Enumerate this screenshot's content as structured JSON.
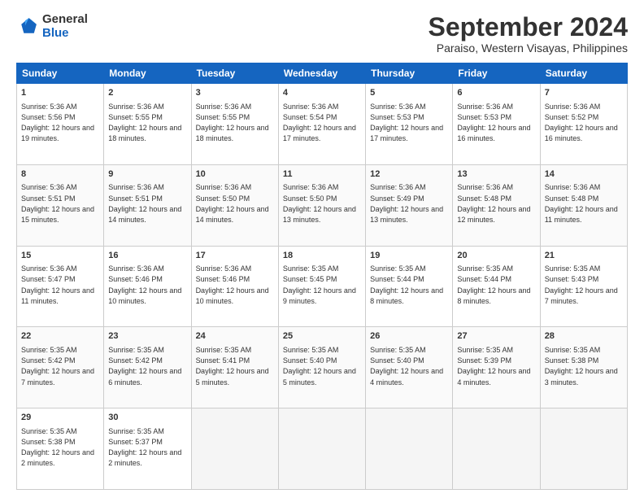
{
  "header": {
    "logo": {
      "line1": "General",
      "line2": "Blue"
    },
    "title": "September 2024",
    "subtitle": "Paraiso, Western Visayas, Philippines"
  },
  "calendar": {
    "weekdays": [
      "Sunday",
      "Monday",
      "Tuesday",
      "Wednesday",
      "Thursday",
      "Friday",
      "Saturday"
    ],
    "weeks": [
      [
        {
          "day": "1",
          "sunrise": "5:36 AM",
          "sunset": "5:56 PM",
          "daylight": "12 hours and 19 minutes."
        },
        {
          "day": "2",
          "sunrise": "5:36 AM",
          "sunset": "5:55 PM",
          "daylight": "12 hours and 18 minutes."
        },
        {
          "day": "3",
          "sunrise": "5:36 AM",
          "sunset": "5:55 PM",
          "daylight": "12 hours and 18 minutes."
        },
        {
          "day": "4",
          "sunrise": "5:36 AM",
          "sunset": "5:54 PM",
          "daylight": "12 hours and 17 minutes."
        },
        {
          "day": "5",
          "sunrise": "5:36 AM",
          "sunset": "5:53 PM",
          "daylight": "12 hours and 17 minutes."
        },
        {
          "day": "6",
          "sunrise": "5:36 AM",
          "sunset": "5:53 PM",
          "daylight": "12 hours and 16 minutes."
        },
        {
          "day": "7",
          "sunrise": "5:36 AM",
          "sunset": "5:52 PM",
          "daylight": "12 hours and 16 minutes."
        }
      ],
      [
        {
          "day": "8",
          "sunrise": "5:36 AM",
          "sunset": "5:51 PM",
          "daylight": "12 hours and 15 minutes."
        },
        {
          "day": "9",
          "sunrise": "5:36 AM",
          "sunset": "5:51 PM",
          "daylight": "12 hours and 14 minutes."
        },
        {
          "day": "10",
          "sunrise": "5:36 AM",
          "sunset": "5:50 PM",
          "daylight": "12 hours and 14 minutes."
        },
        {
          "day": "11",
          "sunrise": "5:36 AM",
          "sunset": "5:50 PM",
          "daylight": "12 hours and 13 minutes."
        },
        {
          "day": "12",
          "sunrise": "5:36 AM",
          "sunset": "5:49 PM",
          "daylight": "12 hours and 13 minutes."
        },
        {
          "day": "13",
          "sunrise": "5:36 AM",
          "sunset": "5:48 PM",
          "daylight": "12 hours and 12 minutes."
        },
        {
          "day": "14",
          "sunrise": "5:36 AM",
          "sunset": "5:48 PM",
          "daylight": "12 hours and 11 minutes."
        }
      ],
      [
        {
          "day": "15",
          "sunrise": "5:36 AM",
          "sunset": "5:47 PM",
          "daylight": "12 hours and 11 minutes."
        },
        {
          "day": "16",
          "sunrise": "5:36 AM",
          "sunset": "5:46 PM",
          "daylight": "12 hours and 10 minutes."
        },
        {
          "day": "17",
          "sunrise": "5:36 AM",
          "sunset": "5:46 PM",
          "daylight": "12 hours and 10 minutes."
        },
        {
          "day": "18",
          "sunrise": "5:35 AM",
          "sunset": "5:45 PM",
          "daylight": "12 hours and 9 minutes."
        },
        {
          "day": "19",
          "sunrise": "5:35 AM",
          "sunset": "5:44 PM",
          "daylight": "12 hours and 8 minutes."
        },
        {
          "day": "20",
          "sunrise": "5:35 AM",
          "sunset": "5:44 PM",
          "daylight": "12 hours and 8 minutes."
        },
        {
          "day": "21",
          "sunrise": "5:35 AM",
          "sunset": "5:43 PM",
          "daylight": "12 hours and 7 minutes."
        }
      ],
      [
        {
          "day": "22",
          "sunrise": "5:35 AM",
          "sunset": "5:42 PM",
          "daylight": "12 hours and 7 minutes."
        },
        {
          "day": "23",
          "sunrise": "5:35 AM",
          "sunset": "5:42 PM",
          "daylight": "12 hours and 6 minutes."
        },
        {
          "day": "24",
          "sunrise": "5:35 AM",
          "sunset": "5:41 PM",
          "daylight": "12 hours and 5 minutes."
        },
        {
          "day": "25",
          "sunrise": "5:35 AM",
          "sunset": "5:40 PM",
          "daylight": "12 hours and 5 minutes."
        },
        {
          "day": "26",
          "sunrise": "5:35 AM",
          "sunset": "5:40 PM",
          "daylight": "12 hours and 4 minutes."
        },
        {
          "day": "27",
          "sunrise": "5:35 AM",
          "sunset": "5:39 PM",
          "daylight": "12 hours and 4 minutes."
        },
        {
          "day": "28",
          "sunrise": "5:35 AM",
          "sunset": "5:38 PM",
          "daylight": "12 hours and 3 minutes."
        }
      ],
      [
        {
          "day": "29",
          "sunrise": "5:35 AM",
          "sunset": "5:38 PM",
          "daylight": "12 hours and 2 minutes."
        },
        {
          "day": "30",
          "sunrise": "5:35 AM",
          "sunset": "5:37 PM",
          "daylight": "12 hours and 2 minutes."
        },
        null,
        null,
        null,
        null,
        null
      ]
    ]
  }
}
